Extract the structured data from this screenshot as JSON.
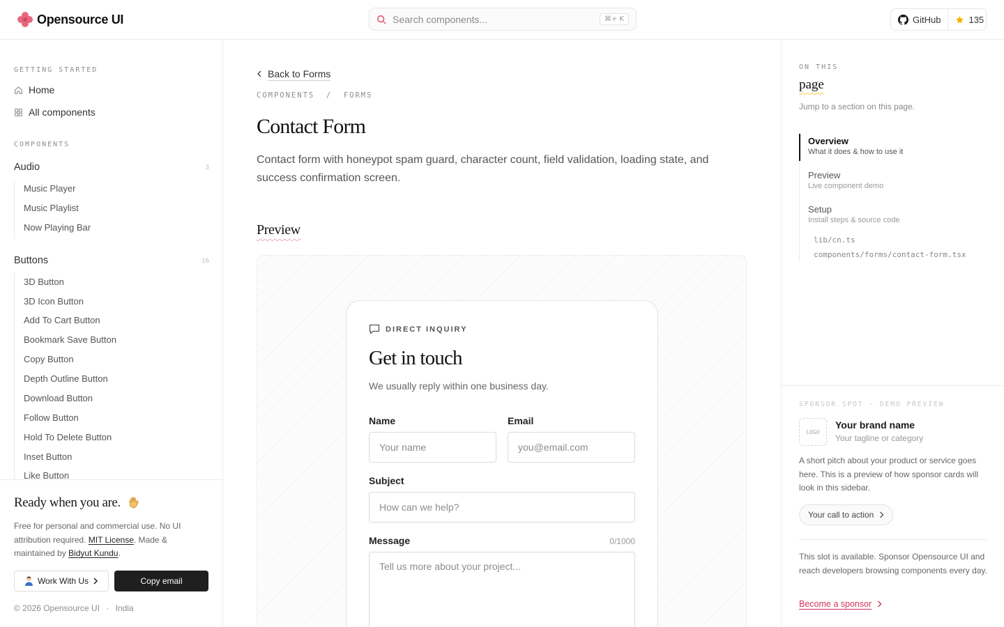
{
  "header": {
    "brand": "Opensource UI",
    "search_placeholder": "Search components...",
    "search_shortcut": "⌘+ K",
    "github_label": "GitHub",
    "stars": "135"
  },
  "sidebar": {
    "getting_started_title": "GETTING STARTED",
    "home": "Home",
    "all_components": "All components",
    "components_title": "COMPONENTS",
    "groups": [
      {
        "label": "Audio",
        "count": "3",
        "items": [
          "Music Player",
          "Music Playlist",
          "Now Playing Bar"
        ]
      },
      {
        "label": "Buttons",
        "count": "16",
        "items": [
          "3D Button",
          "3D Icon Button",
          "Add To Cart Button",
          "Bookmark Save Button",
          "Copy Button",
          "Depth Outline Button",
          "Download Button",
          "Follow Button",
          "Hold To Delete Button",
          "Inset Button",
          "Like Button"
        ]
      }
    ],
    "footer": {
      "heading": "Ready when you are.",
      "text_1": "Free for personal and commercial use. No UI attribution required. ",
      "license_link": "MIT License",
      "text_2": ". Made & maintained by ",
      "author_link": "Bidyut Kundu",
      "text_3": ".",
      "work_button": "Work With Us",
      "copy_button": "Copy email",
      "copyright": "© 2026 Opensource UI",
      "separator": "·",
      "country": "India"
    }
  },
  "main": {
    "back": "Back to Forms",
    "breadcrumb": "COMPONENTS  /  FORMS",
    "title": "Contact Form",
    "description": "Contact form with honeypot spam guard, character count, field validation, loading state, and success confirmation screen.",
    "preview_heading": "Preview",
    "form": {
      "eyebrow": "DIRECT INQUIRY",
      "title": "Get in touch",
      "subtitle": "We usually reply within one business day.",
      "name_label": "Name",
      "name_placeholder": "Your name",
      "email_label": "Email",
      "email_placeholder": "you@email.com",
      "subject_label": "Subject",
      "subject_placeholder": "How can we help?",
      "message_label": "Message",
      "message_count": "0/1000",
      "message_placeholder": "Tell us more about your project..."
    }
  },
  "rail": {
    "on_this": "ON THIS",
    "page": "page",
    "jump": "Jump to a section on this page.",
    "toc": [
      {
        "title": "Overview",
        "subtitle": "What it does & how to use it"
      },
      {
        "title": "Preview",
        "subtitle": "Live component demo"
      },
      {
        "title": "Setup",
        "subtitle": "Install steps & source code"
      }
    ],
    "files": [
      "lib/cn.ts",
      "components/forms/contact-form.tsx"
    ],
    "sponsor": {
      "eyebrow": "SPONSOR SPOT · DEMO PREVIEW",
      "logo": "LOGO",
      "brand_name": "Your brand name",
      "tagline": "Your tagline or category",
      "pitch": "A short pitch about your product or service goes here. This is a preview of how sponsor cards will look in this sidebar.",
      "cta": "Your call to action",
      "slot_text": "This slot is available. Sponsor Opensource UI and reach developers browsing components every day.",
      "become": "Become a sponsor"
    }
  },
  "colors": {
    "accent": "#e8667d",
    "link": "#d6335c",
    "star": "#f5b400"
  }
}
